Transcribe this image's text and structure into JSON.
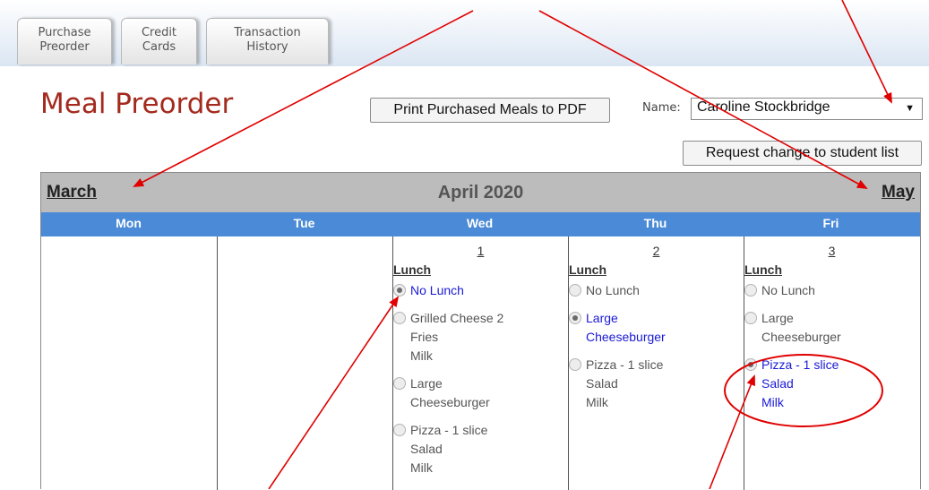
{
  "tabs": [
    {
      "line1": "Purchase",
      "line2": "Preorder"
    },
    {
      "line1": "Credit",
      "line2": "Cards"
    },
    {
      "line1": "Transaction",
      "line2": "History"
    }
  ],
  "page_title": "Meal Preorder",
  "print_button": "Print Purchased Meals to PDF",
  "name_label": "Name:",
  "name_selected": "Caroline Stockbridge",
  "request_button": "Request change to student list",
  "calendar": {
    "prev_month": "March",
    "current_month": "April 2020",
    "next_month": "May",
    "weekdays": [
      "Mon",
      "Tue",
      "Wed",
      "Thu",
      "Fri"
    ],
    "days": [
      {
        "date": "1",
        "meal_label": "Lunch",
        "options": [
          {
            "lines": [
              "No Lunch"
            ],
            "checked": true
          },
          {
            "lines": [
              "Grilled Cheese 2",
              "Fries",
              "Milk"
            ],
            "checked": false
          },
          {
            "lines": [
              "Large",
              "Cheeseburger"
            ],
            "checked": false
          },
          {
            "lines": [
              "Pizza - 1 slice",
              "Salad",
              "Milk"
            ],
            "checked": false
          }
        ]
      },
      {
        "date": "2",
        "meal_label": "Lunch",
        "options": [
          {
            "lines": [
              "No Lunch"
            ],
            "checked": false
          },
          {
            "lines": [
              "Large",
              "Cheeseburger"
            ],
            "checked": true
          },
          {
            "lines": [
              "Pizza - 1 slice",
              "Salad",
              "Milk"
            ],
            "checked": false
          }
        ]
      },
      {
        "date": "3",
        "meal_label": "Lunch",
        "options": [
          {
            "lines": [
              "No Lunch"
            ],
            "checked": false
          },
          {
            "lines": [
              "Large",
              "Cheeseburger"
            ],
            "checked": false
          },
          {
            "lines": [
              "Pizza - 1 slice",
              "Salad",
              "Milk"
            ],
            "checked": true
          }
        ]
      }
    ]
  },
  "colors": {
    "title_red": "#a32a1d",
    "weekday_bar": "#4a8ad6",
    "month_bar": "#bcbcbc",
    "selected_text": "#1a1ad6",
    "annotation_red": "#e00000"
  }
}
